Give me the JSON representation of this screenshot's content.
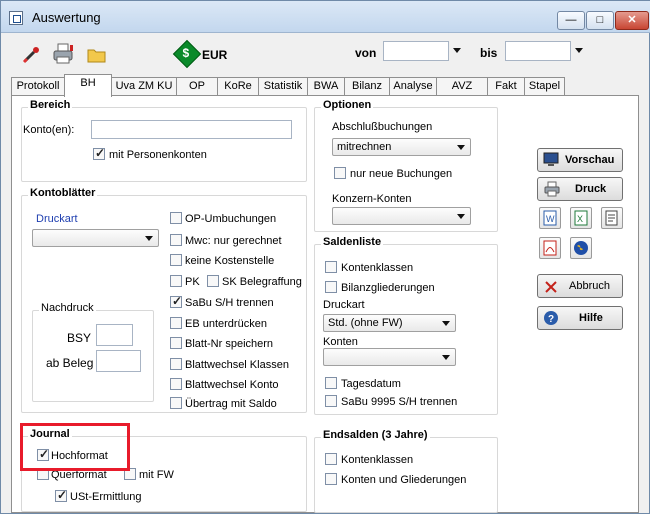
{
  "window": {
    "title": "Auswertung",
    "min_label": "—",
    "max_label": "□",
    "close_label": "✕"
  },
  "toolbar": {
    "currency": "EUR",
    "von_label": "von",
    "bis_label": "bis",
    "von_value": "",
    "bis_value": ""
  },
  "tabs": [
    "Protokoll",
    "BH",
    "Uva ZM KU",
    "OP",
    "KoRe",
    "Statistik",
    "BWA",
    "Bilanz",
    "Analyse",
    "AVZ",
    "Fakt",
    "Stapel"
  ],
  "active_tab": "BH",
  "bereich": {
    "title": "Bereich",
    "konto_label": "Konto(en):",
    "konto_value": "",
    "personenkonten": "mit Personenkonten"
  },
  "optionen": {
    "title": "Optionen",
    "abschluss_label": "Abschlußbuchungen",
    "abschluss_value": "mitrechnen",
    "nur_neue": "nur neue Buchungen",
    "konzern_label": "Konzern-Konten",
    "konzern_value": ""
  },
  "kontoblaetter": {
    "title": "Kontoblätter",
    "druckart_label": "Druckart",
    "druckart_value": "",
    "nachdruck_title": "Nachdruck",
    "bsy_label": "BSY",
    "beleg_label": "ab Beleg",
    "options": {
      "op_umbuchungen": "OP-Umbuchungen",
      "mwc": "Mwc: nur gerechnet",
      "keine_kst": "keine Kostenstelle",
      "pk": "PK",
      "sk_beleg": "SK Belegraffung",
      "sabu": "SaBu S/H trennen",
      "eb": "EB unterdrücken",
      "blatt_nr": "Blatt-Nr speichern",
      "bw_klassen": "Blattwechsel Klassen",
      "bw_konto": "Blattwechsel Konto",
      "uebertrag": "Übertrag mit Saldo"
    }
  },
  "saldenliste": {
    "title": "Saldenliste",
    "kontenklassen": "Kontenklassen",
    "bilanzgl": "Bilanzgliederungen",
    "druckart_label": "Druckart",
    "druckart_value": "Std. (ohne FW)",
    "konten_label": "Konten",
    "konten_value": "",
    "tagesdatum": "Tagesdatum",
    "sabu9995": "SaBu 9995 S/H trennen"
  },
  "journal": {
    "title": "Journal",
    "hochformat": "Hochformat",
    "querformat": "Querformat",
    "mit_fw": "mit FW",
    "ust": "USt-Ermittlung"
  },
  "endsalden": {
    "title": "Endsalden (3 Jahre)",
    "kontenklassen": "Kontenklassen",
    "konten_gl": "Konten und Gliederungen"
  },
  "buttons": {
    "vorschau": "Vorschau",
    "druck": "Druck",
    "abbruch": "Abbruch",
    "hilfe": "Hilfe"
  },
  "colors": {
    "highlight": "#e81b2b",
    "group_title_blue": "#1f3fb0"
  }
}
